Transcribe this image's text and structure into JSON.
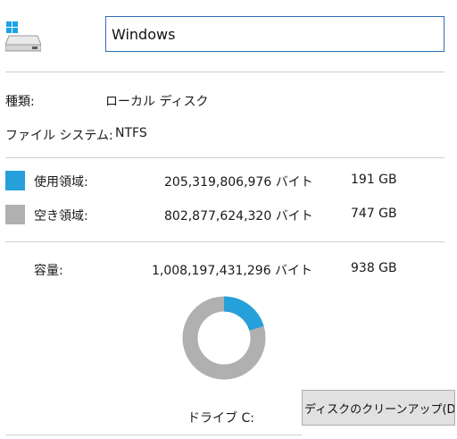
{
  "header": {
    "drive_icon": "windows-drive-icon",
    "volume_name": "Windows"
  },
  "info": {
    "type_label": "種類:",
    "type_value": "ローカル ディスク",
    "fs_label": "ファイル システム:",
    "fs_value": "NTFS"
  },
  "usage": {
    "used_label": "使用領域:",
    "used_bytes": "205,319,806,976 バイト",
    "used_gb": "191 GB",
    "used_color": "#26a0da",
    "free_label": "空き領域:",
    "free_bytes": "802,877,624,320 バイト",
    "free_gb": "747 GB",
    "free_color": "#b0b0b0"
  },
  "capacity": {
    "label": "容量:",
    "bytes": "1,008,197,431,296 バイト",
    "gb": "938 GB"
  },
  "chart": {
    "used_fraction": 0.2036
  },
  "footer": {
    "drive_label": "ドライブ C:",
    "cleanup_button": "ディスクのクリーンアップ(D)"
  }
}
